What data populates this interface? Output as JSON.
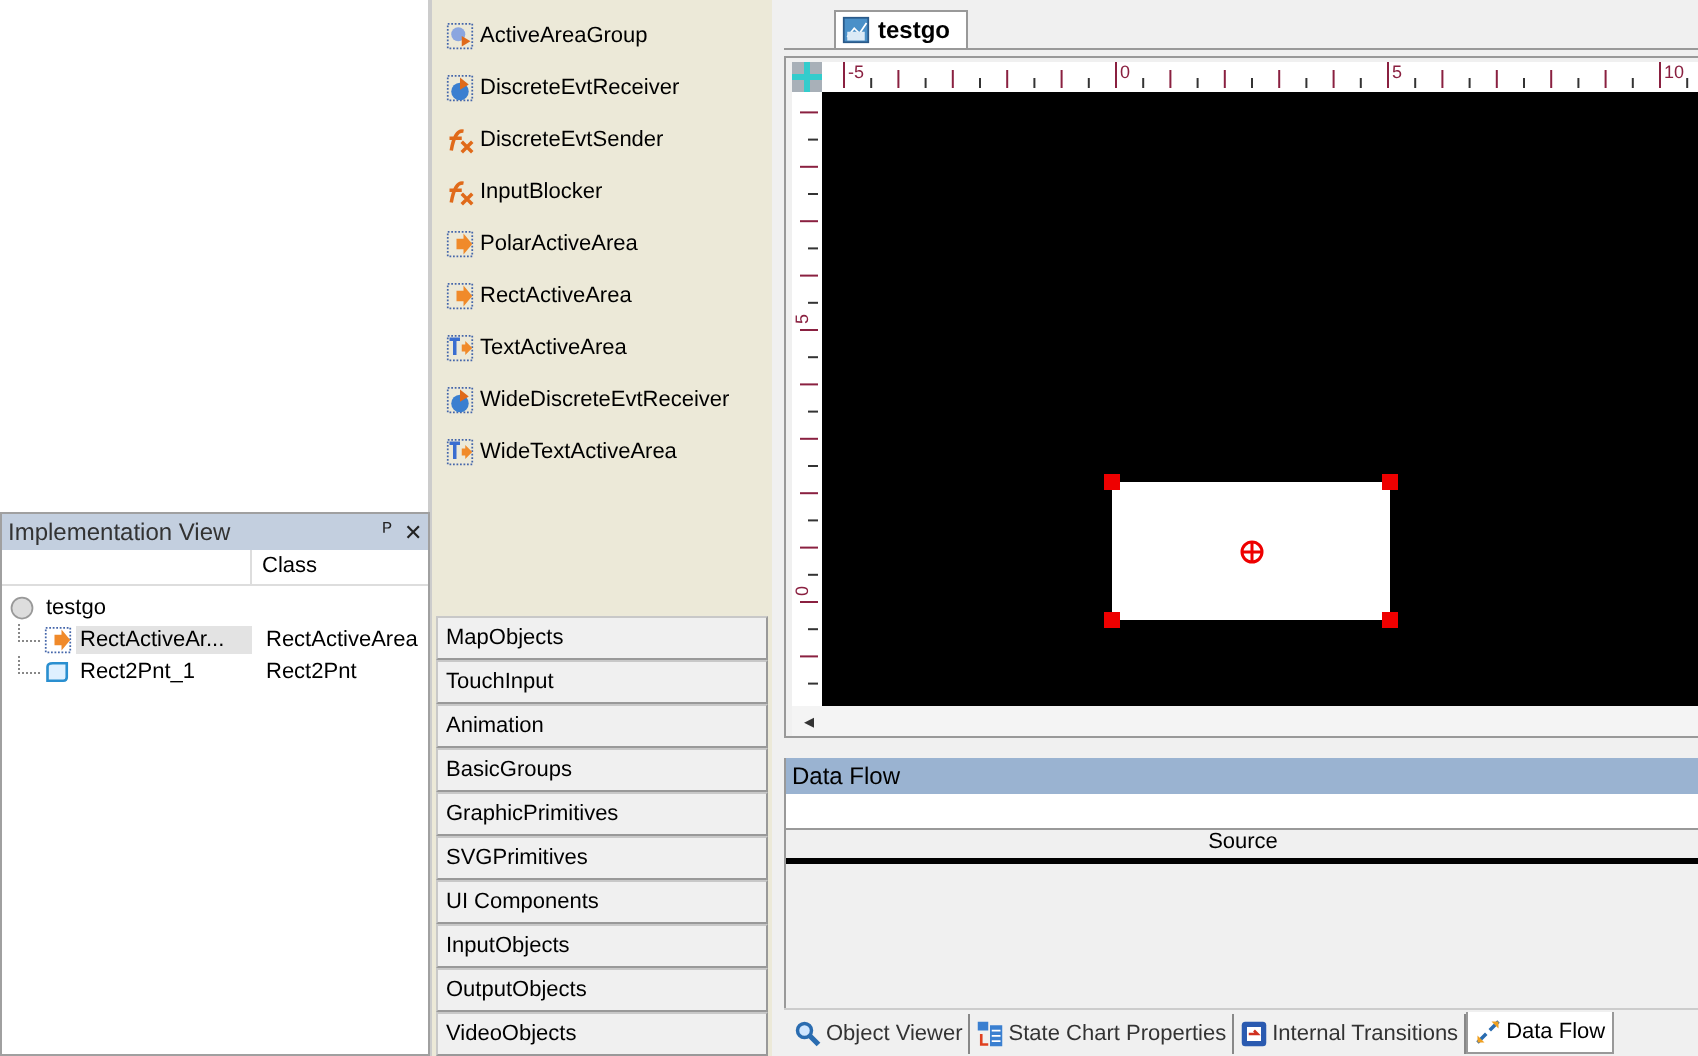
{
  "palette_items": [
    {
      "label": "ActiveAreaGroup",
      "kind": "group"
    },
    {
      "label": "DiscreteEvtReceiver",
      "kind": "receiver"
    },
    {
      "label": "DiscreteEvtSender",
      "kind": "function"
    },
    {
      "label": "InputBlocker",
      "kind": "function"
    },
    {
      "label": "PolarActiveArea",
      "kind": "area"
    },
    {
      "label": "RectActiveArea",
      "kind": "area"
    },
    {
      "label": "TextActiveArea",
      "kind": "text"
    },
    {
      "label": "WideDiscreteEvtReceiver",
      "kind": "receiver"
    },
    {
      "label": "WideTextActiveArea",
      "kind": "text"
    }
  ],
  "palette_categories": [
    "MapObjects",
    "TouchInput",
    "Animation",
    "BasicGroups",
    "GraphicPrimitives",
    "SVGPrimitives",
    "UI Components",
    "InputObjects",
    "OutputObjects",
    "VideoObjects"
  ],
  "implementation_view": {
    "title": "Implementation View",
    "pin": "ᴾ",
    "close": "✕",
    "column": "Class",
    "root": {
      "name": "testgo",
      "children": [
        {
          "name": "RectActiveAr...",
          "class": "RectActiveArea",
          "kind": "area",
          "selected": true
        },
        {
          "name": "Rect2Pnt_1",
          "class": "Rect2Pnt",
          "kind": "shape",
          "selected": false
        }
      ]
    }
  },
  "document_tab": {
    "label": "testgo",
    "selected": true
  },
  "ruler": {
    "top_labels": [
      "-5",
      "0",
      "5",
      "10"
    ],
    "left_labels": [
      "5",
      "0"
    ]
  },
  "canvas_object": {
    "selected": true
  },
  "scroll_arrow": "◂",
  "data_flow": {
    "title": "Data Flow",
    "column": "Source"
  },
  "bottom_tabs": [
    {
      "label": "Object Viewer",
      "kind": "viewer",
      "selected": false
    },
    {
      "label": "State Chart Properties",
      "kind": "properties",
      "selected": false
    },
    {
      "label": "Internal Transitions",
      "kind": "transitions",
      "selected": false
    },
    {
      "label": "Data Flow",
      "kind": "flow",
      "selected": true
    }
  ]
}
